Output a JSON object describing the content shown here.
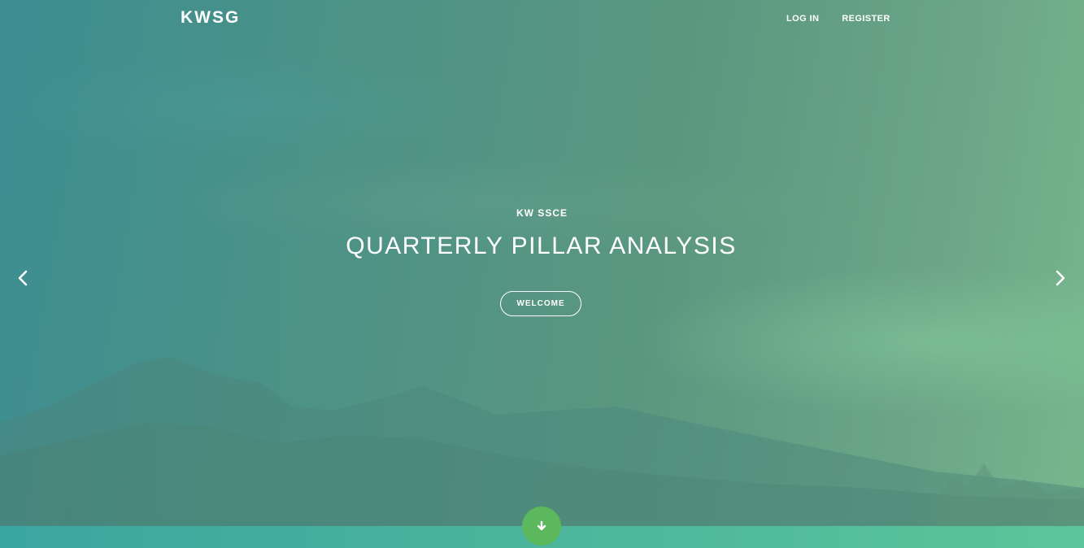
{
  "header": {
    "brand": "KWSG",
    "nav": [
      {
        "label": "LOG IN"
      },
      {
        "label": "REGISTER"
      }
    ]
  },
  "hero": {
    "kicker": "KW SSCE",
    "headline": "QUARTERLY PILLAR ANALYSIS",
    "cta_label": "WELCOME"
  },
  "icons": {
    "prev": "chevron-left-icon",
    "next": "chevron-right-icon",
    "scroll": "arrow-down-icon"
  },
  "colors": {
    "accent": "#5cb85c",
    "band_start": "#3aa6a0",
    "band_end": "#5cc59a",
    "text": "#ffffff"
  }
}
